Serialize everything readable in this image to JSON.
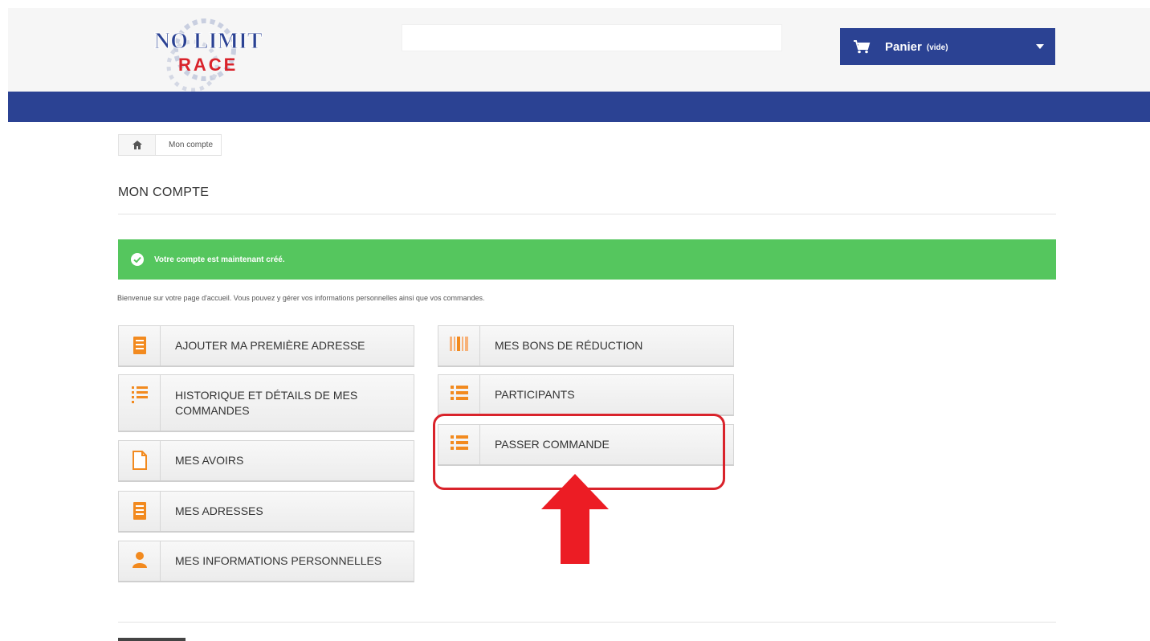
{
  "header": {
    "logo_text_top": "NO LIMIT",
    "logo_text_bottom": "RACE",
    "cart_label": "Panier",
    "cart_state": "(vide)"
  },
  "breadcrumb": {
    "home_icon": "home-icon",
    "current": "Mon compte"
  },
  "page": {
    "title": "MON COMPTE",
    "alert_text": "Votre compte est maintenant créé.",
    "welcome_text": "Bienvenue sur votre page d'accueil. Vous pouvez y gérer vos informations personnelles ainsi que vos commandes."
  },
  "left_buttons": [
    {
      "label": "AJOUTER MA PREMIÈRE ADRESSE",
      "icon": "building-icon"
    },
    {
      "label": "HISTORIQUE ET DÉTAILS DE MES COMMANDES",
      "icon": "ordered-list-icon"
    },
    {
      "label": "MES AVOIRS",
      "icon": "file-icon"
    },
    {
      "label": "MES ADRESSES",
      "icon": "building-icon"
    },
    {
      "label": "MES INFORMATIONS PERSONNELLES",
      "icon": "user-icon"
    }
  ],
  "right_buttons": [
    {
      "label": "MES BONS DE RÉDUCTION",
      "icon": "barcode-icon"
    },
    {
      "label": "PARTICIPANTS",
      "icon": "list-icon"
    },
    {
      "label": "PASSER COMMANDE",
      "icon": "list-icon"
    }
  ],
  "colors": {
    "brand_blue": "#2b4293",
    "alert_green": "#55c65e",
    "icon_orange": "#f28a1f",
    "annotation_red": "#d9232b"
  }
}
